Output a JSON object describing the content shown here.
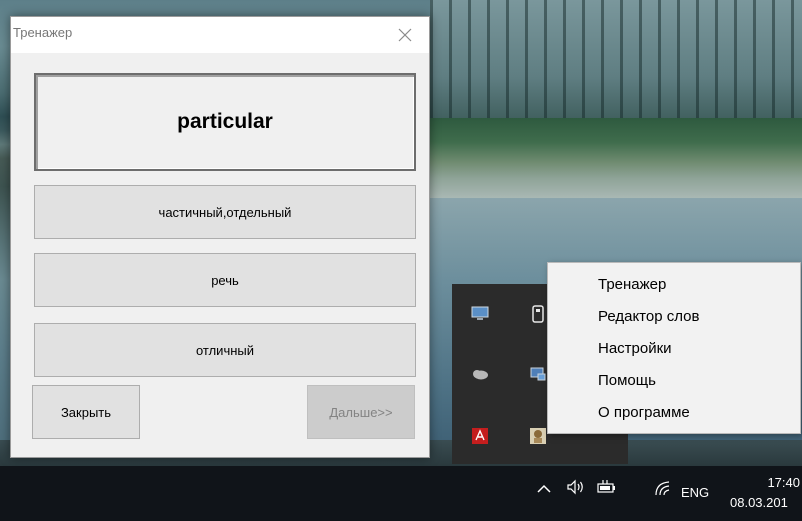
{
  "window": {
    "title": "Тренажер",
    "word": "particular",
    "options": [
      "частичный,отдельный",
      "речь",
      "отличный"
    ],
    "close_label": "Закрыть",
    "next_label": "Дальше>>"
  },
  "context_menu": {
    "items": [
      "Тренажер",
      "Редактор слов",
      "Настройки",
      "Помощь",
      "О программе"
    ]
  },
  "taskbar": {
    "language": "ENG",
    "time": "17:40",
    "date": "08.03.201",
    "icons": [
      "chevron-up-icon",
      "speaker-icon",
      "battery-icon",
      "wifi-icon"
    ]
  },
  "tray_icons": [
    "monitor-icon",
    "usb-drive-icon",
    "cloud-icon",
    "network-icon",
    "adobe-icon",
    "app-icon"
  ],
  "colors": {
    "window_bg": "#f0f0f0",
    "button_bg": "#e1e1e1",
    "disabled_text": "#838383",
    "menu_bg": "#f2f2f2",
    "taskbar_bg": "#101419",
    "tray_bg": "#2b2b2b"
  }
}
